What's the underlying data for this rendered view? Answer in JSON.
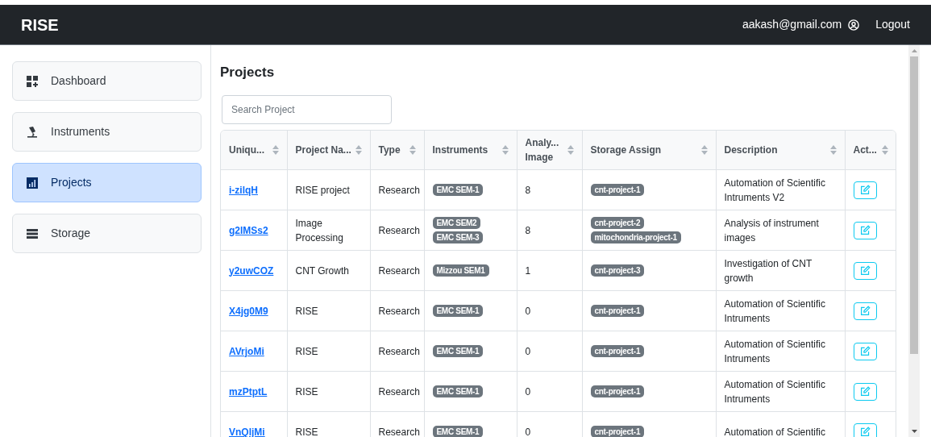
{
  "header": {
    "brand": "RISE",
    "user_email": "aakash@gmail.com",
    "logout": "Logout"
  },
  "sidebar": {
    "items": [
      {
        "label": "Dashboard",
        "kind": "dashboard",
        "selected": false
      },
      {
        "label": "Instruments",
        "kind": "microscope",
        "selected": false
      },
      {
        "label": "Projects",
        "kind": "chart",
        "selected": true
      },
      {
        "label": "Storage",
        "kind": "storage",
        "selected": false
      }
    ]
  },
  "page_title": "Projects",
  "search": {
    "placeholder": "Search Project"
  },
  "table": {
    "columns": [
      "Uniqu...",
      "Project Na...",
      "Type",
      "Instruments",
      "Analy... Image",
      "Storage Assign",
      "Description",
      "Act..."
    ],
    "rows": [
      {
        "id": "i-zilqH",
        "name": "RISE project",
        "type": "Research",
        "instruments": [
          "EMC SEM-1"
        ],
        "analyzed": "8",
        "storage": [
          "cnt-project-1"
        ],
        "description": "Automation of Scientific Intruments V2"
      },
      {
        "id": "g2IMSs2",
        "name": "Image Processing",
        "type": "Research",
        "instruments": [
          "EMC SEM2",
          "EMC SEM-3"
        ],
        "analyzed": "8",
        "storage": [
          "cnt-project-2",
          "mitochondria-project-1"
        ],
        "description": "Analysis of instrument images"
      },
      {
        "id": "y2uwCOZ",
        "name": "CNT Growth",
        "type": "Research",
        "instruments": [
          "Mizzou SEM1"
        ],
        "analyzed": "1",
        "storage": [
          "cnt-project-3"
        ],
        "description": "Investigation of CNT growth"
      },
      {
        "id": "X4jg0M9",
        "name": "RISE",
        "type": "Research",
        "instruments": [
          "EMC SEM-1"
        ],
        "analyzed": "0",
        "storage": [
          "cnt-project-1"
        ],
        "description": "Automation of Scientific Intruments"
      },
      {
        "id": "AVrjoMi",
        "name": "RISE",
        "type": "Research",
        "instruments": [
          "EMC SEM-1"
        ],
        "analyzed": "0",
        "storage": [
          "cnt-project-1"
        ],
        "description": "Automation of Scientific Intruments"
      },
      {
        "id": "mzPtptL",
        "name": "RISE",
        "type": "Research",
        "instruments": [
          "EMC SEM-1"
        ],
        "analyzed": "0",
        "storage": [
          "cnt-project-1"
        ],
        "description": "Automation of Scientific Intruments"
      },
      {
        "id": "VnQljMi",
        "name": "RISE",
        "type": "Research",
        "instruments": [
          "EMC SEM-1"
        ],
        "analyzed": "0",
        "storage": [
          "cnt-project-1"
        ],
        "description": "Automation of Scientific"
      }
    ]
  }
}
